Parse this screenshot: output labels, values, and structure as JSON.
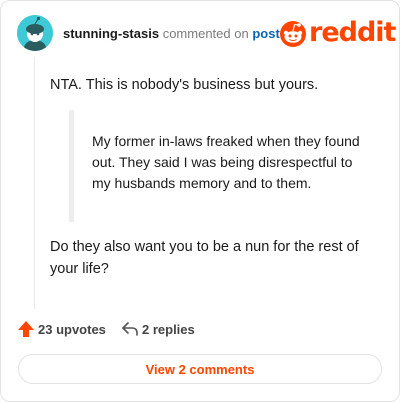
{
  "header": {
    "username": "stunning-stasis",
    "action_text": "commented on",
    "post_link": "post",
    "logo_text": "reddit",
    "logo_icon": "reddit-alien-icon",
    "avatar_icon": "snoo-avatar-icon"
  },
  "comment": {
    "text": "NTA. This is nobody's business but yours.",
    "quote": "My former in-laws freaked when they found out. They said I was being disrespectful to my husbands memory and to them.",
    "text_2": "Do they also want you to be a nun for the rest of your life?"
  },
  "footer": {
    "upvotes": "23 upvotes",
    "replies": "2 replies",
    "upvote_icon": "upvote-arrow-icon",
    "reply_icon": "reply-arrow-icon"
  },
  "view_comments_label": "View 2 comments",
  "colors": {
    "accent": "#ff4500",
    "link": "#0b64b6",
    "avatar_bg": "#3fc9d6"
  }
}
